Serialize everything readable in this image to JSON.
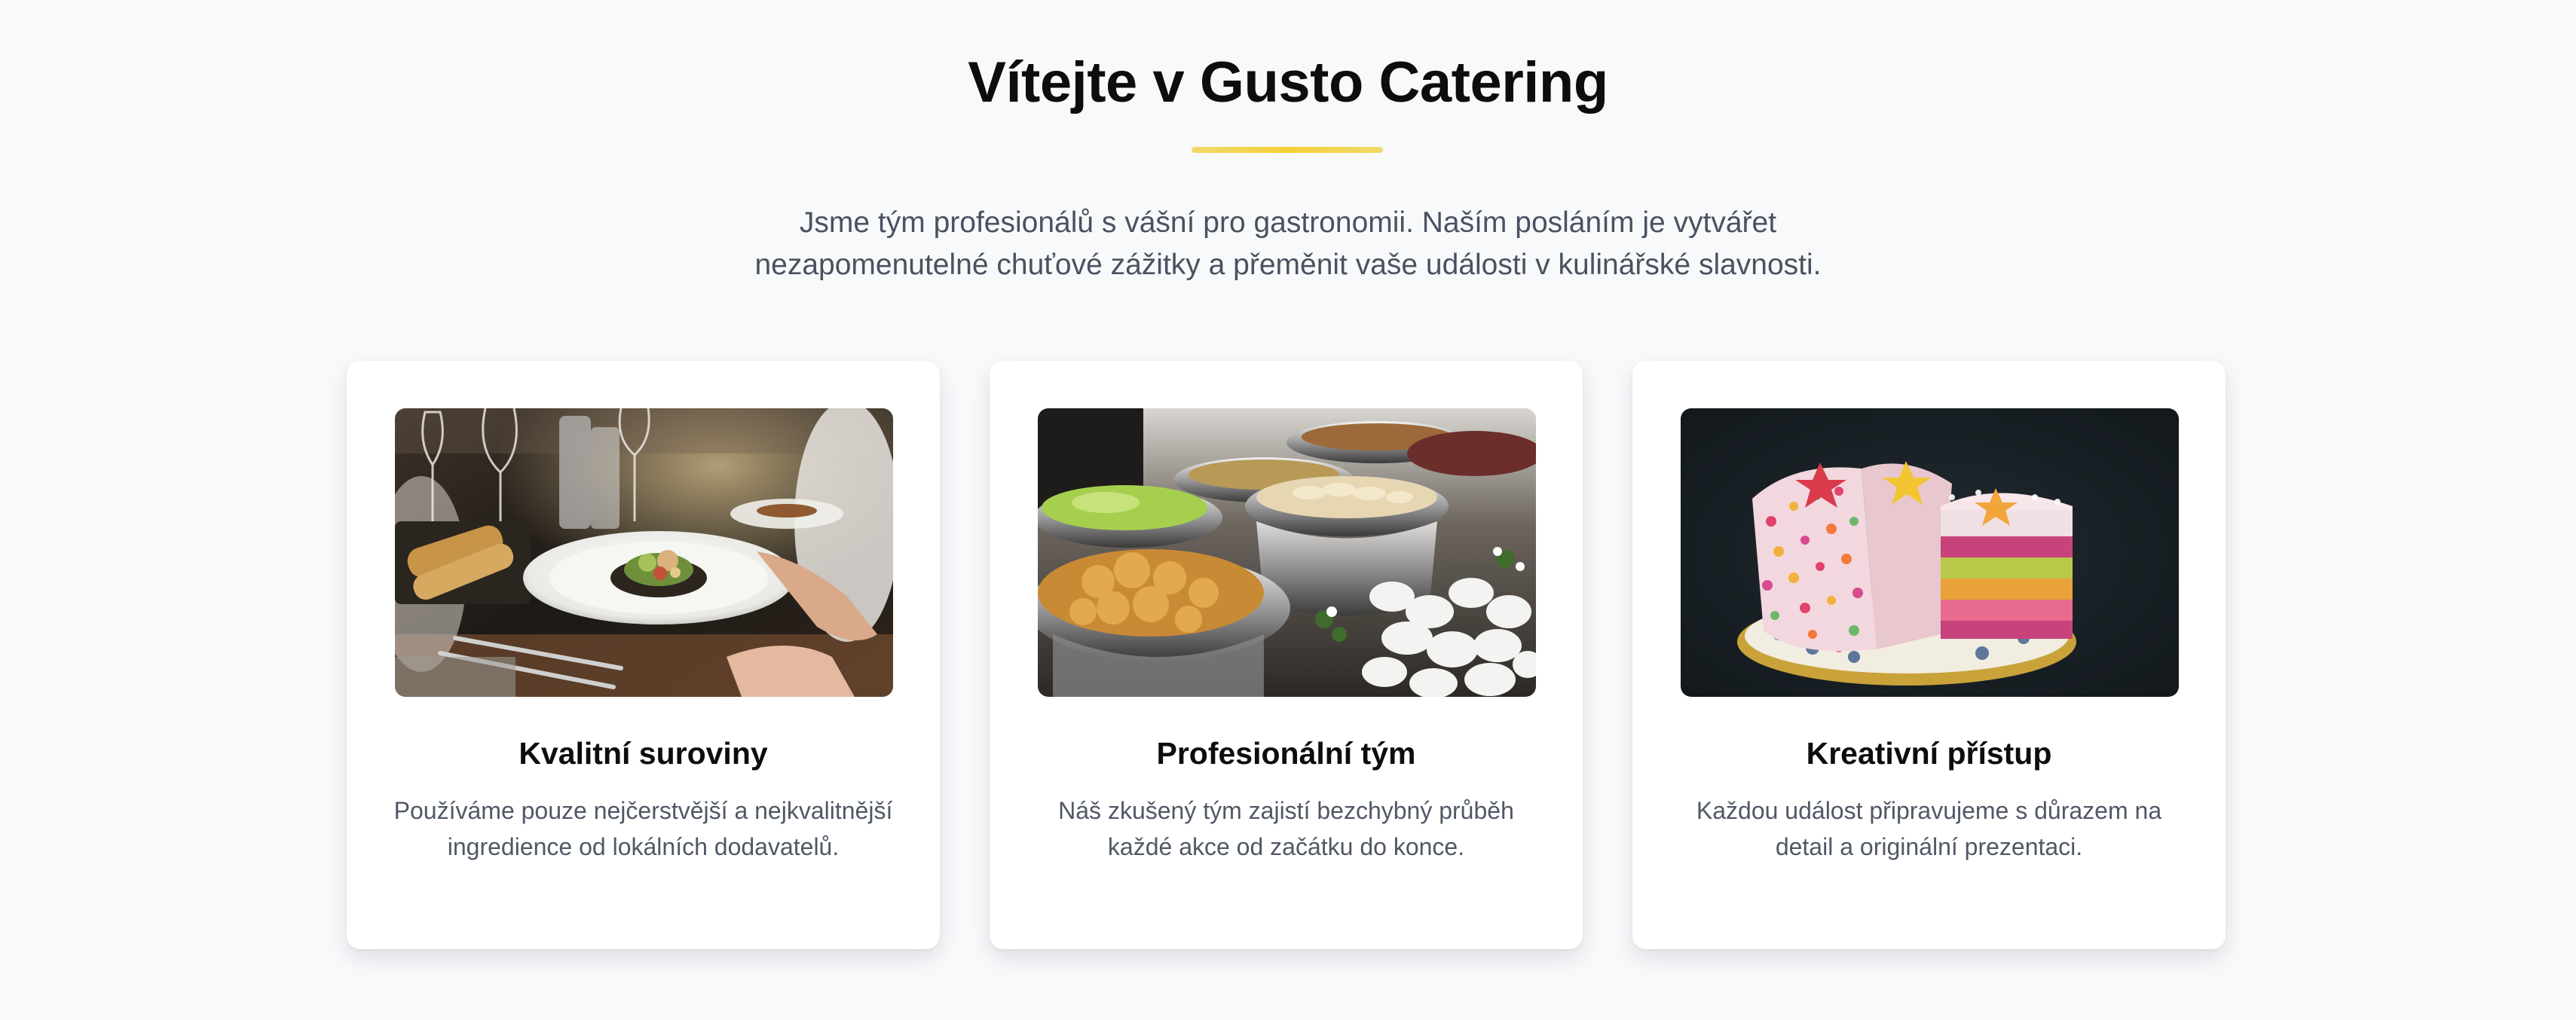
{
  "hero": {
    "title": "Vítejte v Gusto Catering",
    "intro": "Jsme tým profesionálů s vášní pro gastronomii. Naším posláním je vytvářet nezapomenutelné chuťové zážitky a přeměnit vaše události v kulinářské slavnosti.",
    "accent_color": "#f4cf38"
  },
  "cards": [
    {
      "title": "Kvalitní suroviny",
      "text": "Používáme pouze nejčerstvější a nejkvalitnější ingredience od lokálních dodavatelů.",
      "image": "plated-dish-on-dining-table"
    },
    {
      "title": "Profesionální tým",
      "text": "Náš zkušený tým zajistí bezchybný průběh každé akce od začátku do konce.",
      "image": "catering-buffet-chafing-dishes"
    },
    {
      "title": "Kreativní přístup",
      "text": "Každou událost připravujeme s důrazem na detail a originální prezentaci.",
      "image": "colorful-layered-cake-slice"
    }
  ]
}
